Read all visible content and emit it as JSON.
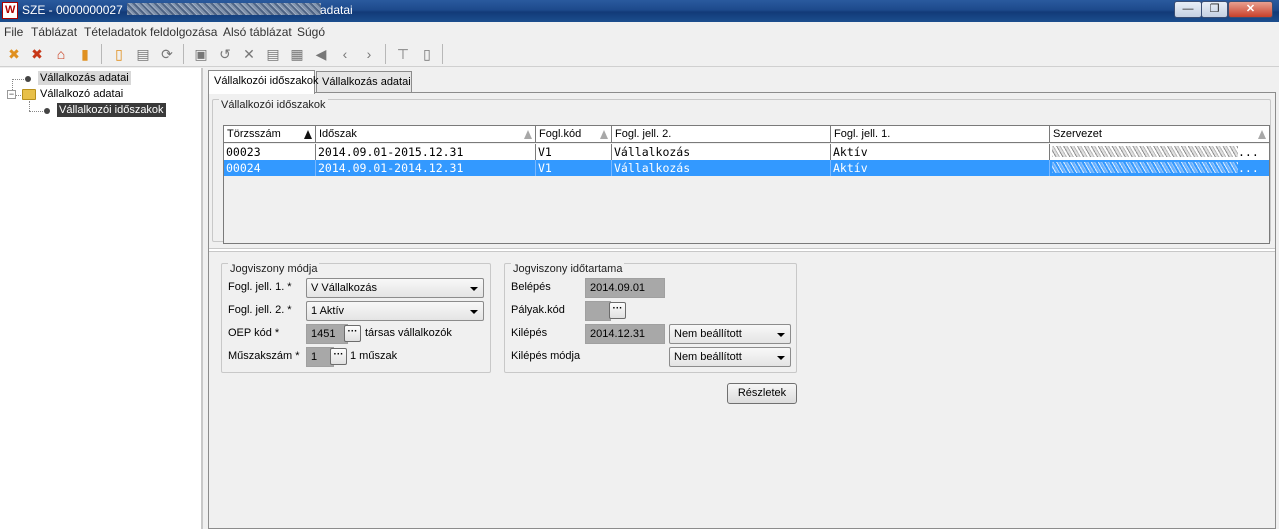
{
  "window": {
    "title_prefix": "SZE - 0000000027",
    "title_suffix": "adatai",
    "minimize_label": "—",
    "maximize_label": "❐",
    "close_label": "✕"
  },
  "menu": {
    "items": [
      "File",
      "Táblázat",
      "Tételadatok feldolgozása",
      "Alsó táblázat",
      "Súgó"
    ]
  },
  "toolbar": {
    "icons": [
      "delete-record-icon",
      "delete-all-icon",
      "home-icon",
      "exit-door-icon",
      "new-document-icon",
      "print-icon",
      "refresh-icon",
      "save-icon",
      "undo-icon",
      "cancel-icon",
      "print-preview-icon",
      "calculator-icon",
      "back-icon",
      "previous-icon",
      "next-icon",
      "first-page-icon",
      "copy-document-icon"
    ]
  },
  "tree": {
    "root": "Vállalkozás adatai",
    "group": "Vállalkozó adatai",
    "child": "Vállalkozói időszakok",
    "expander": "−"
  },
  "tabs": [
    "Vállalkozói időszakok",
    "Vállalkozás adatai"
  ],
  "periods_group": {
    "title": "Vállalkozói időszakok",
    "columns": [
      "Törzsszám",
      "Időszak",
      "Fogl.kód",
      "Fogl. jell. 2.",
      "Fogl. jell. 1.",
      "Szervezet"
    ],
    "rows": [
      {
        "torzsszam": "00023",
        "idoszak": "2014.09.01-2015.12.31",
        "fogl_kod": "V1",
        "fogl_jell_2": "Vállalkozás",
        "fogl_jell_1": "Aktív",
        "szervezet_tail": "..."
      },
      {
        "torzsszam": "00024",
        "idoszak": "2014.09.01-2014.12.31",
        "fogl_kod": "V1",
        "fogl_jell_2": "Vállalkozás",
        "fogl_jell_1": "Aktív",
        "szervezet_tail": "..."
      }
    ],
    "selected_row": 1
  },
  "jogviszony_modja": {
    "title": "Jogviszony módja",
    "fogl_jell_1_label": "Fogl. jell. 1. *",
    "fogl_jell_1_value": "V Vállalkozás",
    "fogl_jell_2_label": "Fogl. jell. 2. *",
    "fogl_jell_2_value": "1 Aktív",
    "oep_label": "OEP kód *",
    "oep_value": "1451",
    "oep_desc": "társas vállalkozók",
    "muszak_label": "Műszakszám *",
    "muszak_value": "1",
    "muszak_desc": "1 műszak",
    "dots": "···"
  },
  "jogviszony_idotartama": {
    "title": "Jogviszony időtartama",
    "belepes_label": "Belépés",
    "belepes_value": "2014.09.01",
    "palyak_label": "Pályak.kód",
    "palyak_value": "",
    "kilepes_label": "Kilépés",
    "kilepes_value": "2014.12.31",
    "kilepes_select": "Nem beállított",
    "kilepes_modja_label": "Kilépés módja",
    "kilepes_modja_select": "Nem beállított"
  },
  "details_button": "Részletek",
  "colors": {
    "titlebar": "#1d4a8c",
    "selection": "#3399ff",
    "readonly_field": "#a8a8a8"
  }
}
